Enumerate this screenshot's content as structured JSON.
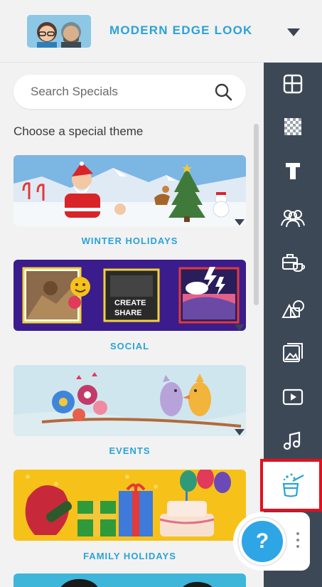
{
  "header": {
    "project_title": "MODERN EDGE LOOK"
  },
  "search": {
    "placeholder": "Search Specials"
  },
  "panel": {
    "prompt": "Choose a special theme"
  },
  "themes": [
    {
      "label": "WINTER HOLIDAYS"
    },
    {
      "label": "SOCIAL",
      "thumbnail_text": [
        "CREATE",
        "SHARE"
      ]
    },
    {
      "label": "EVENTS"
    },
    {
      "label": "FAMILY HOLIDAYS"
    }
  ],
  "toolbar": {
    "items": [
      {
        "icon": "layout-icon"
      },
      {
        "icon": "background-pattern-icon"
      },
      {
        "icon": "text-icon"
      },
      {
        "icon": "characters-icon"
      },
      {
        "icon": "props-icon"
      },
      {
        "icon": "shapes-icon"
      },
      {
        "icon": "images-icon"
      },
      {
        "icon": "video-icon"
      },
      {
        "icon": "music-icon"
      },
      {
        "icon": "specials-magic-hat-icon",
        "active": true
      }
    ]
  },
  "help": {
    "label": "?"
  },
  "colors": {
    "accent": "#2aa3d8",
    "toolbar_bg": "#3d4857",
    "panel_bg": "#f2f2f2",
    "highlight": "#e60f1f",
    "help_button": "#2ea6e6"
  }
}
